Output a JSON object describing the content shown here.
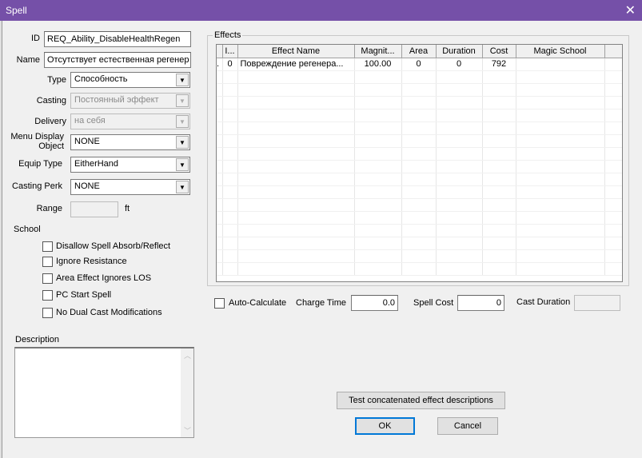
{
  "window": {
    "title": "Spell",
    "close_icon": "close-icon"
  },
  "form": {
    "id_label": "ID",
    "id_value": "REQ_Ability_DisableHealthRegen",
    "name_label": "Name",
    "name_value": "Отсутствует естественная регенер",
    "type_label": "Type",
    "type_value": "Способность",
    "casting_label": "Casting",
    "casting_value": "Постоянный эффект",
    "delivery_label": "Delivery",
    "delivery_value": "на себя",
    "menu_display_label": "Menu Display Object",
    "menu_display_value": "NONE",
    "equip_type_label": "Equip Type",
    "equip_type_value": "EitherHand",
    "casting_perk_label": "Casting Perk",
    "casting_perk_value": "NONE",
    "range_label": "Range",
    "range_value": "",
    "range_unit": "ft",
    "school_label": "School",
    "checkboxes": [
      {
        "label": "Disallow Spell Absorb/Reflect",
        "checked": false
      },
      {
        "label": "Ignore Resistance",
        "checked": false
      },
      {
        "label": "Area Effect Ignores LOS",
        "checked": false
      },
      {
        "label": "PC Start Spell",
        "checked": false
      },
      {
        "label": "No Dual Cast Modifications",
        "checked": false
      }
    ],
    "description_label": "Description",
    "description_value": ""
  },
  "effects": {
    "group_label": "Effects",
    "columns": [
      "",
      "I...",
      "Effect Name",
      "Magnit...",
      "Area",
      "Duration",
      "Cost",
      "Magic School",
      ""
    ],
    "rows": [
      [
        ".",
        "0",
        "Повреждение регенера...",
        "100.00",
        "0",
        "0",
        "792",
        "",
        ""
      ]
    ]
  },
  "bottom": {
    "auto_calc_label": "Auto-Calculate",
    "auto_calc_checked": false,
    "charge_time_label": "Charge Time",
    "charge_time_value": "0.0",
    "spell_cost_label": "Spell Cost",
    "spell_cost_value": "0",
    "cast_duration_label": "Cast Duration",
    "cast_duration_value": "",
    "test_button": "Test concatenated effect descriptions",
    "ok_button": "OK",
    "cancel_button": "Cancel"
  }
}
